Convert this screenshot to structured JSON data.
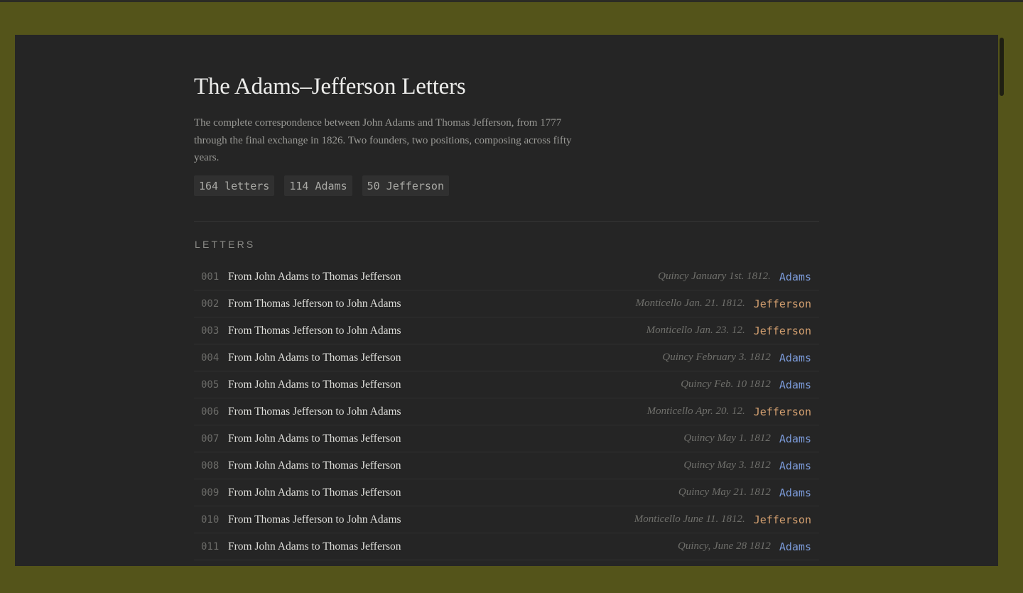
{
  "page": {
    "title": "The Adams–Jefferson Letters",
    "description": "The complete correspondence between John Adams and Thomas Jefferson, from 1777 through the final exchange in 1826. Two founders, two positions, composing across fifty years."
  },
  "stats": {
    "letters": "164 letters",
    "adams": "114 Adams",
    "jefferson": "50 Jefferson"
  },
  "section": {
    "label": "LETTERS"
  },
  "colors": {
    "frame": "#54541a",
    "panel": "#252525",
    "adams": "#7b9ad8",
    "jefferson": "#d4a070"
  },
  "letters": [
    {
      "num": "001",
      "title": "From John Adams to Thomas Jefferson",
      "place": "Quincy January 1st. 1812.",
      "author": "Adams"
    },
    {
      "num": "002",
      "title": "From Thomas Jefferson to John Adams",
      "place": "Monticello Jan. 21. 1812.",
      "author": "Jefferson"
    },
    {
      "num": "003",
      "title": "From Thomas Jefferson to John Adams",
      "place": "Monticello Jan. 23. 12.",
      "author": "Jefferson"
    },
    {
      "num": "004",
      "title": "From John Adams to Thomas Jefferson",
      "place": "Quincy February 3. 1812",
      "author": "Adams"
    },
    {
      "num": "005",
      "title": "From John Adams to Thomas Jefferson",
      "place": "Quincy Feb. 10 1812",
      "author": "Adams"
    },
    {
      "num": "006",
      "title": "From Thomas Jefferson to John Adams",
      "place": "Monticello Apr. 20. 12.",
      "author": "Jefferson"
    },
    {
      "num": "007",
      "title": "From John Adams to Thomas Jefferson",
      "place": "Quincy May 1. 1812",
      "author": "Adams"
    },
    {
      "num": "008",
      "title": "From John Adams to Thomas Jefferson",
      "place": "Quincy May 3. 1812",
      "author": "Adams"
    },
    {
      "num": "009",
      "title": "From John Adams to Thomas Jefferson",
      "place": "Quincy May 21. 1812",
      "author": "Adams"
    },
    {
      "num": "010",
      "title": "From Thomas Jefferson to John Adams",
      "place": "Monticello June 11. 1812.",
      "author": "Jefferson"
    },
    {
      "num": "011",
      "title": "From John Adams to Thomas Jefferson",
      "place": "Quincy, June 28 1812",
      "author": "Adams"
    }
  ]
}
